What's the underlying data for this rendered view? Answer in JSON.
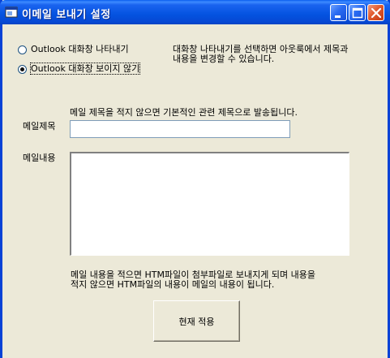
{
  "window": {
    "title": "이메일 보내기 설정"
  },
  "options": {
    "show_dialog_label": "Outlook 대화창 나타내기",
    "hide_dialog_label": "Outlook 대화창 보이지 않기",
    "selected": "hide",
    "help_line1": "대화창 나타내기를 선택하면 아웃룩에서 제목과",
    "help_line2": "내용을 변경할 수 있습니다."
  },
  "subject": {
    "hint": "메일 제목을 적지 않으면 기본적인 관련 제목으로 발송됩니다.",
    "label": "메일제목",
    "value": ""
  },
  "body": {
    "label": "메일내용",
    "value": "",
    "hint_line1": "메일 내용을 적으면 HTM파일이 첨부파일로 보내지게 되며 내용을",
    "hint_line2": "적지 않으면 HTM파일의 내용이 메일의 내용이 됩니다."
  },
  "apply_button": {
    "label": "현재 적용"
  }
}
